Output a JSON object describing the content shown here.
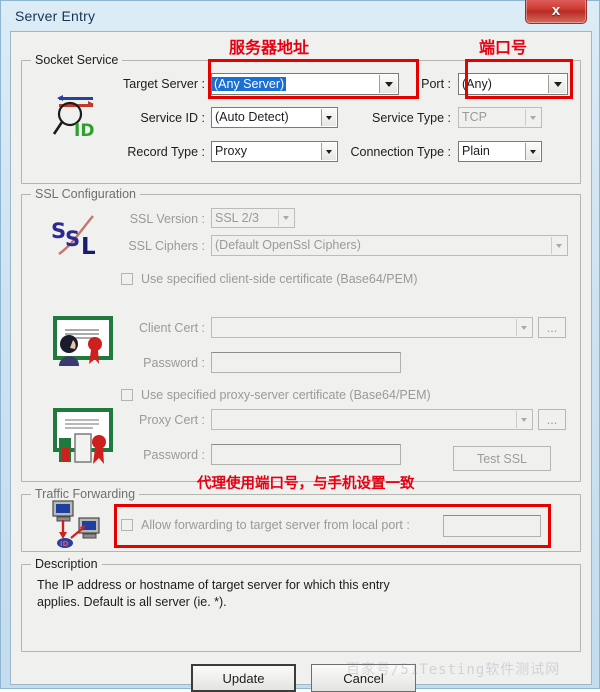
{
  "window": {
    "title": "Server Entry",
    "close_label": "x"
  },
  "socket_service": {
    "legend": "Socket Service",
    "icon_name": "magnifier-id-icon",
    "target_server": {
      "label": "Target Server :",
      "value": "(Any Server)"
    },
    "port": {
      "label": "Port :",
      "value": "(Any)"
    },
    "service_id": {
      "label": "Service ID :",
      "value": "(Auto Detect)"
    },
    "service_type": {
      "label": "Service Type :",
      "value": "TCP"
    },
    "record_type": {
      "label": "Record Type :",
      "value": "Proxy"
    },
    "connection_type": {
      "label": "Connection Type :",
      "value": "Plain"
    }
  },
  "ssl_configuration": {
    "legend": "SSL Configuration",
    "ssl_icon_name": "ssl-logo-icon",
    "client_cert_icon_name": "client-certificate-icon",
    "proxy_cert_icon_name": "proxy-certificate-icon",
    "ssl_version": {
      "label": "SSL Version :",
      "value": "SSL 2/3"
    },
    "ssl_ciphers": {
      "label": "SSL Ciphers :",
      "value": "(Default OpenSsl Ciphers)"
    },
    "use_client_cert": {
      "label": "Use specified client-side certificate (Base64/PEM)",
      "checked": false
    },
    "client_cert": {
      "label": "Client Cert :",
      "value": ""
    },
    "client_password": {
      "label": "Password :",
      "value": ""
    },
    "use_proxy_cert": {
      "label": "Use specified proxy-server certificate (Base64/PEM)",
      "checked": false
    },
    "proxy_cert": {
      "label": "Proxy Cert :",
      "value": ""
    },
    "proxy_password": {
      "label": "Password :",
      "value": ""
    },
    "browse_label": "...",
    "test_ssl_label": "Test SSL"
  },
  "traffic_forwarding": {
    "legend": "Traffic Forwarding",
    "icon_name": "port-forwarding-icon",
    "allow_forwarding": {
      "label": "Allow forwarding to target server from local port :",
      "checked": false
    },
    "local_port": {
      "value": ""
    }
  },
  "description": {
    "legend": "Description",
    "text": "The IP address or hostname of target server for which this entry\napplies.  Default is all server (ie. *)."
  },
  "buttons": {
    "update": "Update",
    "cancel": "Cancel"
  },
  "annotations": {
    "server_address": "服务器地址",
    "port_number": "端口号",
    "proxy_port_note": "代理使用端口号，与手机设置一致",
    "accent_color": "#e60012"
  },
  "watermark": {
    "text": "百家号/51Testing软件测试网"
  }
}
